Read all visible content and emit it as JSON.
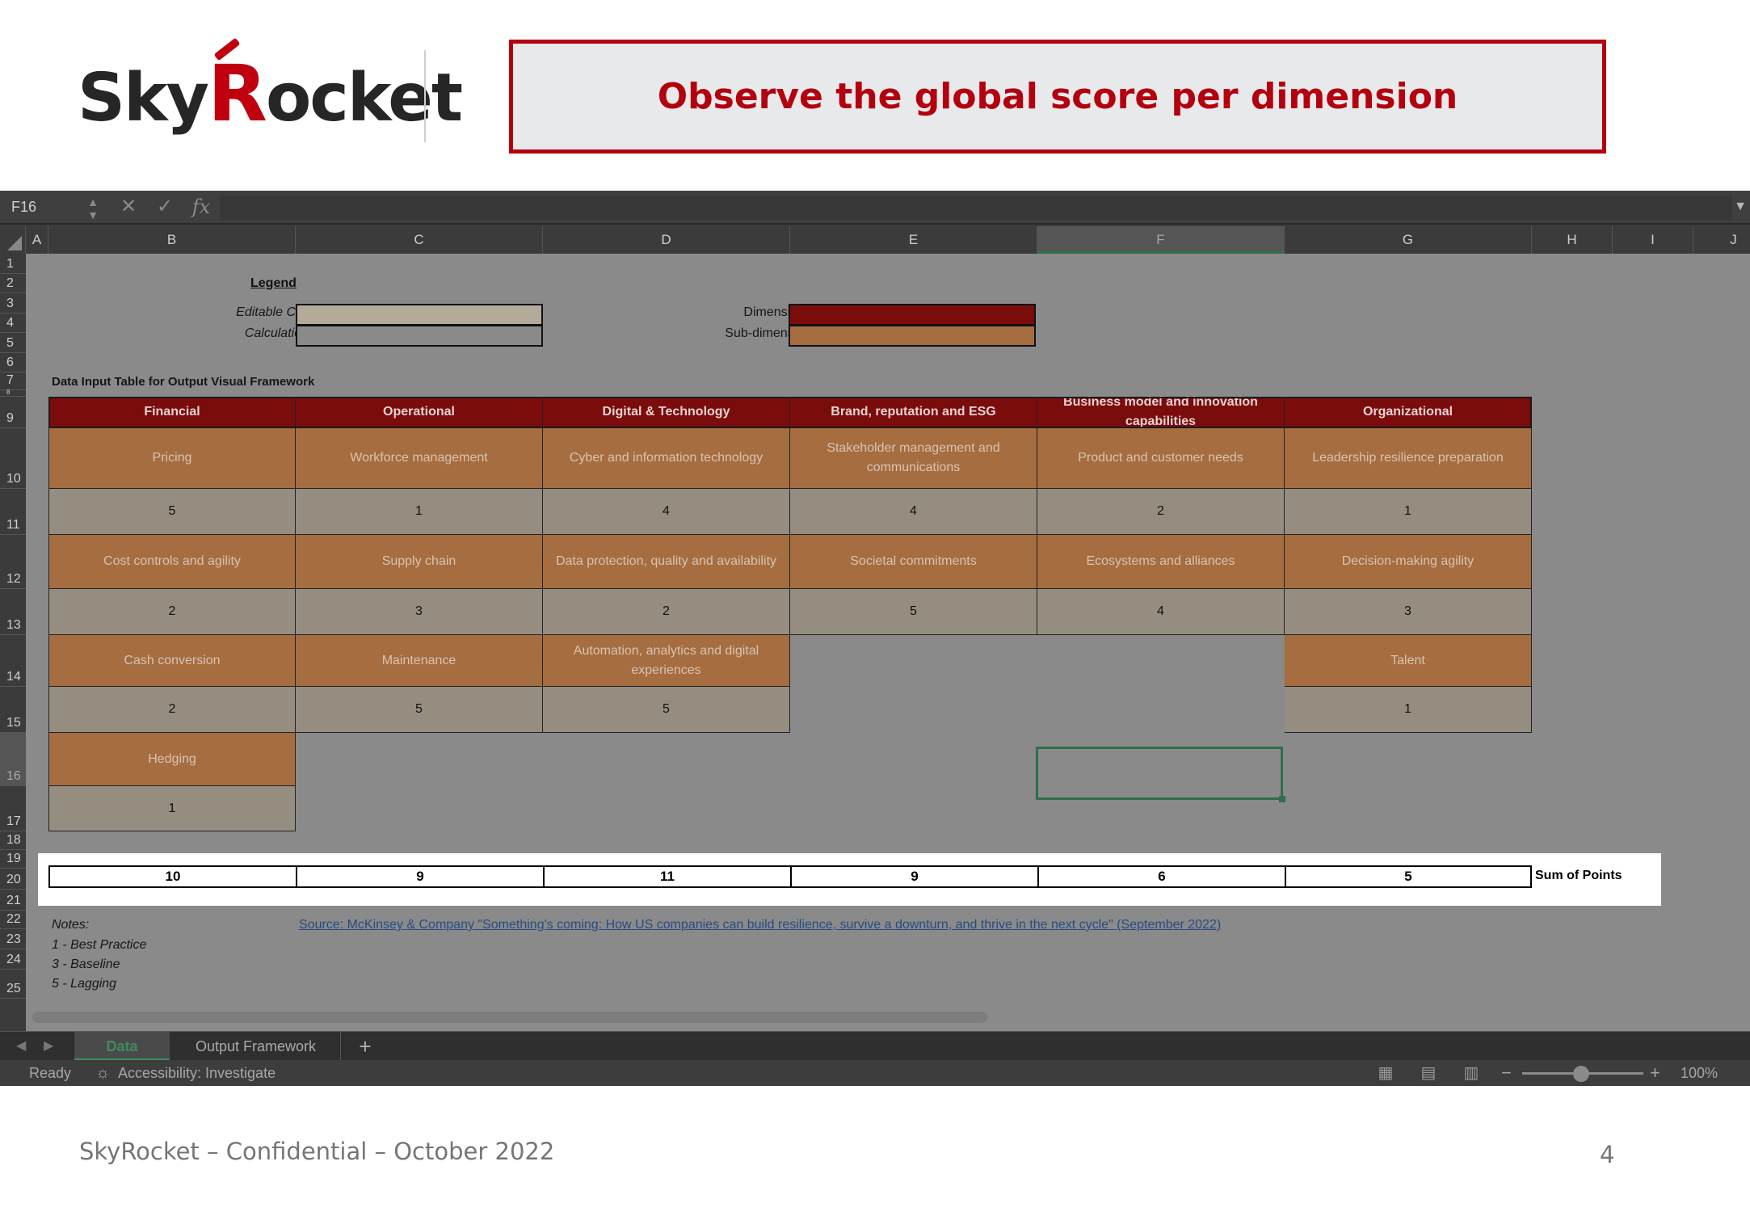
{
  "slide": {
    "logo_part1": "Sky",
    "logo_r": "R",
    "logo_part2": "ocket",
    "title": "Observe the global score per dimension",
    "footer": "SkyRocket – Confidential – October 2022",
    "page_number": "4"
  },
  "excel": {
    "name_box": "F16",
    "columns": [
      "A",
      "B",
      "C",
      "D",
      "E",
      "F",
      "G",
      "H",
      "I",
      "J"
    ],
    "rows": [
      "1",
      "2",
      "3",
      "4",
      "5",
      "6",
      "7",
      "8",
      "9",
      "10",
      "11",
      "12",
      "13",
      "14",
      "15",
      "16",
      "17",
      "18",
      "19",
      "20",
      "21",
      "22",
      "23",
      "24",
      "25"
    ],
    "selected_cell": "F16",
    "legend": {
      "heading": "Legend",
      "editable_label": "Editable Cells",
      "calculations_label": "Calculations",
      "dimensions_label": "Dimensions",
      "subdimension_label": "Sub-dimension"
    },
    "table_title": "Data Input Table for Output Visual Framework",
    "dimensions": [
      {
        "name": "Financial",
        "subs": [
          {
            "name": "Pricing",
            "value": "5"
          },
          {
            "name": "Cost controls and agility",
            "value": "2"
          },
          {
            "name": "Cash conversion",
            "value": "2"
          },
          {
            "name": "Hedging",
            "value": "1"
          }
        ],
        "sum": "10"
      },
      {
        "name": "Operational",
        "subs": [
          {
            "name": "Workforce management",
            "value": "1"
          },
          {
            "name": "Supply chain",
            "value": "3"
          },
          {
            "name": "Maintenance",
            "value": "5"
          }
        ],
        "sum": "9"
      },
      {
        "name": "Digital & Technology",
        "subs": [
          {
            "name": "Cyber and information technology",
            "value": "4"
          },
          {
            "name": "Data protection, quality and availability",
            "value": "2"
          },
          {
            "name": "Automation, analytics and digital experiences",
            "value": "5"
          }
        ],
        "sum": "11"
      },
      {
        "name": "Brand, reputation and ESG",
        "subs": [
          {
            "name": "Stakeholder management and communications",
            "value": "4"
          },
          {
            "name": "Societal commitments",
            "value": "5"
          }
        ],
        "sum": "9"
      },
      {
        "name": "Business model and innovation capabilities",
        "subs": [
          {
            "name": "Product and customer needs",
            "value": "2"
          },
          {
            "name": "Ecosystems and alliances",
            "value": "4"
          }
        ],
        "sum": "6"
      },
      {
        "name": "Organizational",
        "subs": [
          {
            "name": "Leadership resilience preparation",
            "value": "1"
          },
          {
            "name": "Decision-making agility",
            "value": "3"
          },
          {
            "name": "Talent",
            "value": "1"
          }
        ],
        "sum": "5"
      }
    ],
    "sum_label": "Sum of Points",
    "notes": {
      "heading": "Notes:",
      "items": [
        "1 - Best Practice",
        "3 - Baseline",
        "5 - Lagging"
      ]
    },
    "source_link": "Source: McKinsey & Company \"Something's coming: How US companies can build resilience, survive a downturn, and thrive in the next cycle\" (September 2022)",
    "sheet_tabs": {
      "active": "Data",
      "other": "Output Framework",
      "add": "+"
    },
    "status": {
      "ready": "Ready",
      "accessibility": "Accessibility: Investigate",
      "zoom": "100%"
    },
    "colors": {
      "dimension": "#7a0c0c",
      "subdimension": "#a56d40",
      "value_cell": "#948d80",
      "selection": "#2f6e4c",
      "title_red": "#b3000f"
    }
  }
}
